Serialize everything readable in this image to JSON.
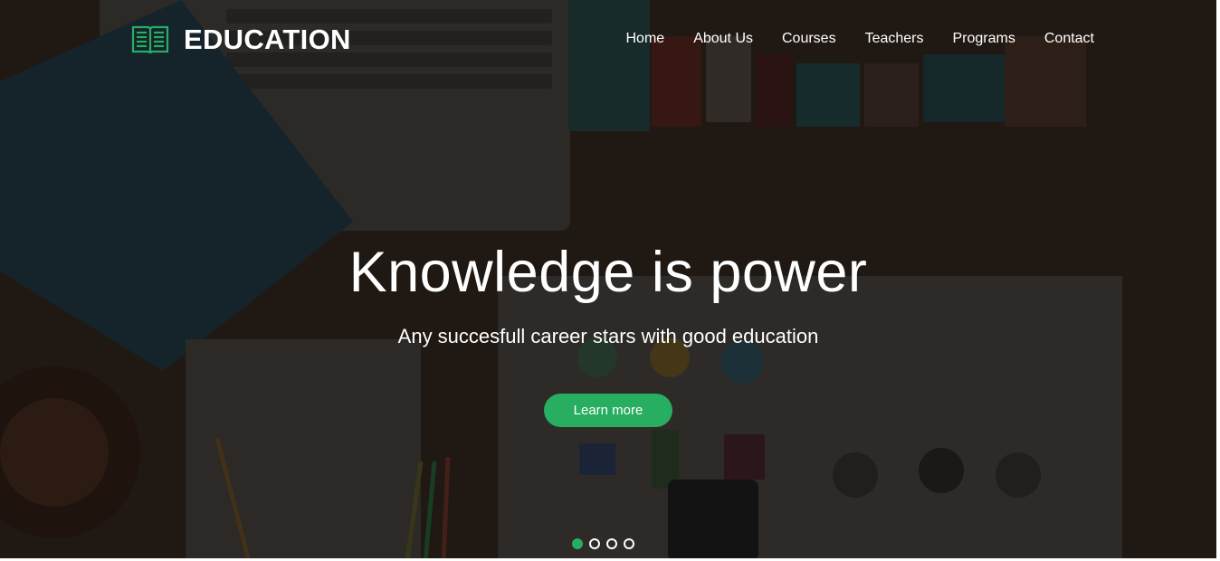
{
  "brand": {
    "name": "EDUCATION",
    "icon": "open-book-icon",
    "accent": "#27ae60"
  },
  "nav": {
    "items": [
      {
        "label": "Home"
      },
      {
        "label": "About Us"
      },
      {
        "label": "Courses"
      },
      {
        "label": "Teachers"
      },
      {
        "label": "Programs"
      },
      {
        "label": "Contact"
      }
    ]
  },
  "hero": {
    "headline": "Knowledge is power",
    "subheadline": "Any succesfull career stars with good education",
    "cta_label": "Learn more"
  },
  "slider": {
    "slide_count": 4,
    "active_slide": 1
  }
}
